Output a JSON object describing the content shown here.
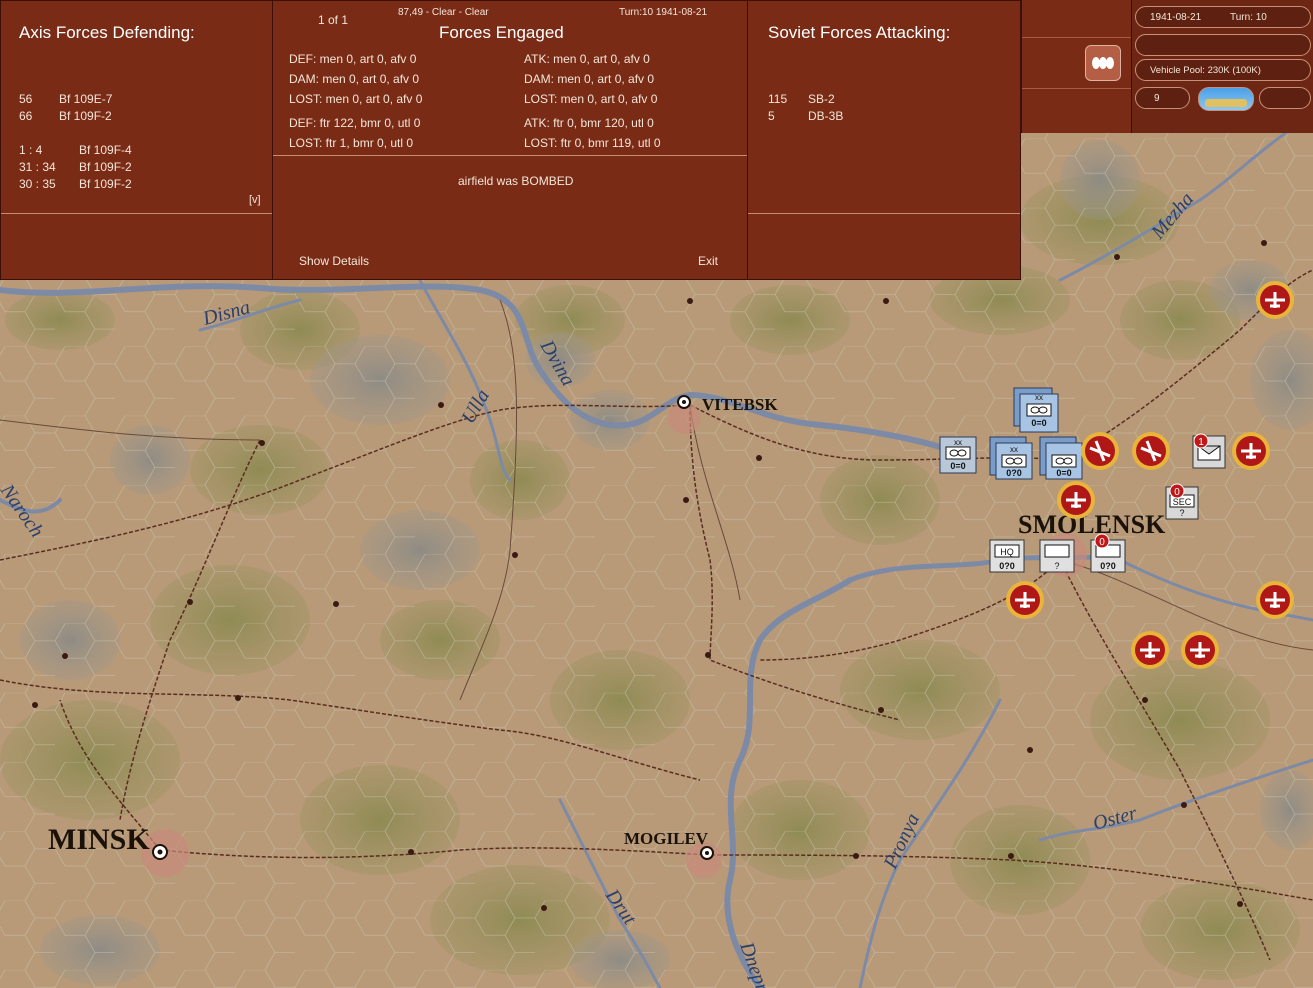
{
  "defending": {
    "title": "Axis Forces Defending:",
    "units": [
      {
        "count": "56",
        "name": "Bf 109E-7"
      },
      {
        "count": "66",
        "name": "Bf 109F-2"
      }
    ],
    "losses": [
      {
        "ratio": "1 : 4",
        "name": "Bf 109F-4"
      },
      {
        "ratio": "31 : 34",
        "name": "Bf 109F-2"
      },
      {
        "ratio": "30 : 35",
        "name": "Bf 109F-2"
      }
    ],
    "expand": "[v]"
  },
  "engaged": {
    "page": "1 of 1",
    "info": "87,49 - Clear - Clear",
    "turn": "Turn:10  1941-08-21",
    "title": "Forces Engaged",
    "def_lines": [
      "DEF: men 0, art 0, afv 0",
      "DAM: men 0, art 0, afv 0",
      "LOST: men 0, art 0, afv 0",
      "DEF: ftr 122, bmr 0, utl 0",
      "LOST: ftr 1, bmr 0, utl 0"
    ],
    "atk_lines": [
      "ATK: men 0, art 0, afv 0",
      "DAM: men 0, art 0, afv 0",
      "LOST: men 0, art 0, afv 0",
      "ATK: ftr 0, bmr 120, utl 0",
      "LOST: ftr 0, bmr 119, utl 0"
    ],
    "result": "airfield was BOMBED",
    "show_details": "Show Details",
    "exit": "Exit"
  },
  "attacking": {
    "title": "Soviet Forces Attacking:",
    "units": [
      {
        "count": "115",
        "name": "SB-2"
      },
      {
        "count": "5",
        "name": "DB-3B"
      }
    ]
  },
  "status": {
    "date": "1941-08-21",
    "turn": "Turn: 10",
    "vehicle_pool": "Vehicle Pool: 230K (100K)",
    "counter": "9"
  },
  "map": {
    "cities": [
      "VITEBSK",
      "SMOLENSK",
      "MINSK",
      "MOGILEV"
    ],
    "rivers": [
      "Disna",
      "Ulla",
      "Dvina",
      "Mezha",
      "Naroch",
      "Pronya",
      "Oster",
      "Drut",
      "Dnepr"
    ],
    "unit_labels": {
      "hq": "HQ",
      "sec": "SEC",
      "q": "?",
      "zero_zero": "0=0",
      "zero_q_zero": "0?0",
      "xx": "xx"
    },
    "badges": [
      "1",
      "0",
      "0"
    ]
  },
  "colors": {
    "panel": "#7a2b16",
    "map_base": "#b89a78",
    "forest": "#8e8a4e",
    "marsh": "#8a8a88",
    "river": "#7d8aa6",
    "soviet_air": "#b01818"
  }
}
